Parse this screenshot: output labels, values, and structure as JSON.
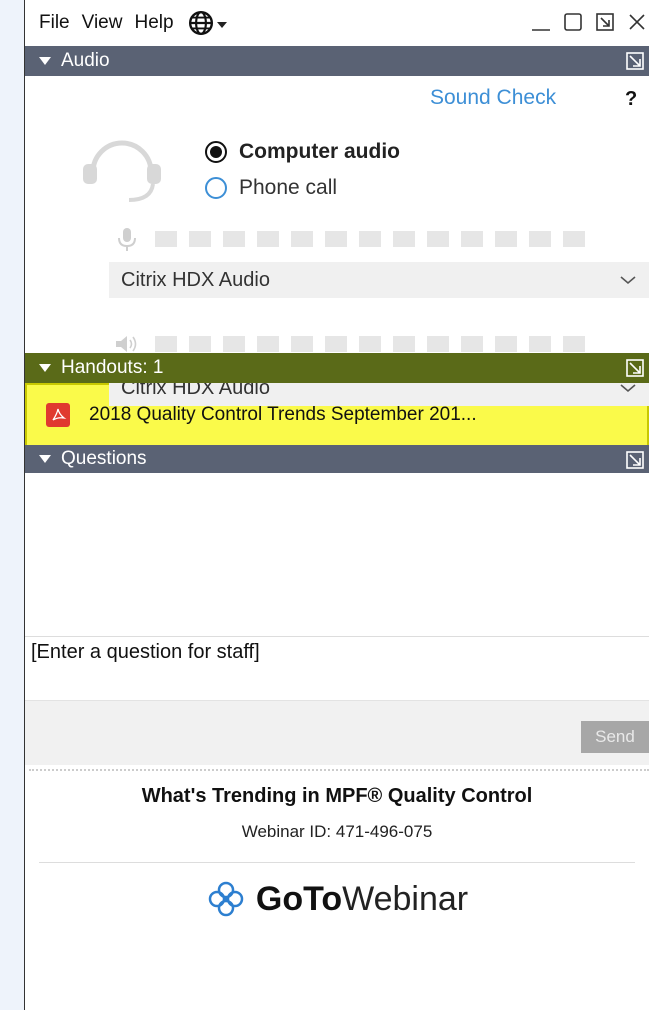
{
  "menu": {
    "file": "File",
    "view": "View",
    "help": "Help"
  },
  "audio": {
    "section_title": "Audio",
    "sound_check": "Sound Check",
    "help_glyph": "?",
    "options": [
      {
        "label": "Computer audio",
        "selected": true
      },
      {
        "label": "Phone call",
        "selected": false
      }
    ],
    "microphone_device": "Citrix HDX Audio",
    "speaker_device": "Citrix HDX Audio"
  },
  "handouts": {
    "section_title": "Handouts: 1",
    "items": [
      {
        "name": "2018 Quality Control Trends September 201..."
      }
    ]
  },
  "questions": {
    "section_title": "Questions",
    "input_placeholder": "[Enter a question for staff]",
    "send_label": "Send"
  },
  "footer": {
    "title": "What's Trending in MPF® Quality Control",
    "webinar_id": "Webinar ID: 471-496-075",
    "brand_bold": "GoTo",
    "brand_light": "Webinar"
  },
  "colors": {
    "section_bar": "#5a6274",
    "highlight": "#fafa4a",
    "link": "#3d8fd6",
    "pdf": "#e03a2f"
  }
}
